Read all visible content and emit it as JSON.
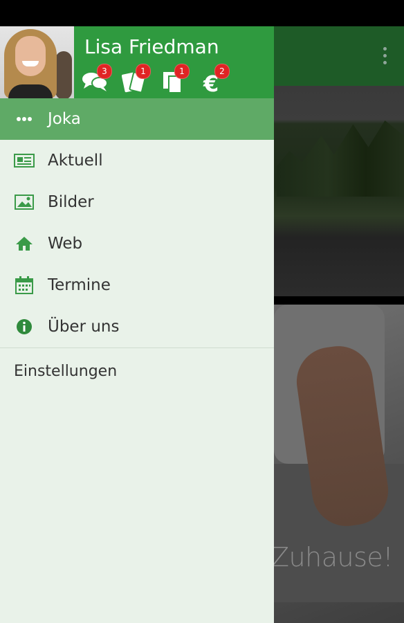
{
  "user": {
    "name": "Lisa Friedman"
  },
  "badges": [
    {
      "icon": "chat-icon",
      "count": "3"
    },
    {
      "icon": "cards-icon",
      "count": "1"
    },
    {
      "icon": "documents-icon",
      "count": "1"
    },
    {
      "icon": "euro-icon",
      "count": "2"
    }
  ],
  "menu": {
    "items": [
      {
        "label": "Joka",
        "icon": "dots-icon",
        "active": true
      },
      {
        "label": "Aktuell",
        "icon": "newspaper-icon"
      },
      {
        "label": "Bilder",
        "icon": "image-icon"
      },
      {
        "label": "Web",
        "icon": "home-icon"
      },
      {
        "label": "Termine",
        "icon": "calendar-icon"
      },
      {
        "label": "Über uns",
        "icon": "info-icon"
      }
    ],
    "settings_label": "Einstellungen"
  },
  "background": {
    "tagline": "Zuhause!"
  },
  "colors": {
    "brand_green": "#2f9a3f",
    "active_item": "#5faa66",
    "drawer_bg": "#e9f2e9",
    "badge_red": "#e02424"
  }
}
